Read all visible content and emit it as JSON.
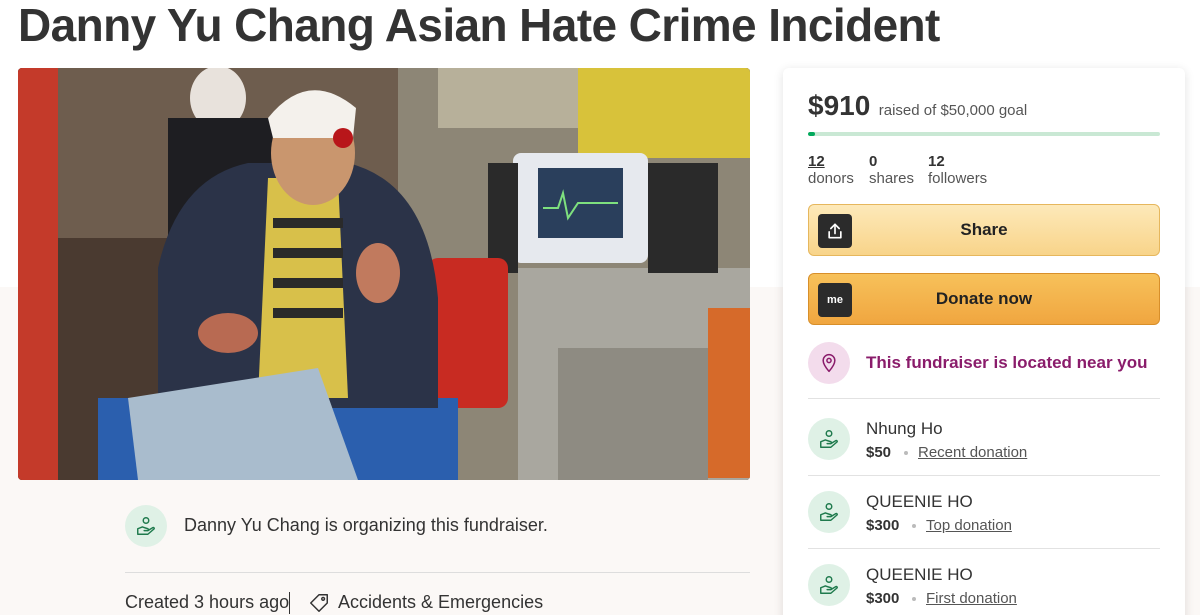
{
  "page": {
    "title": "Danny Yu Chang Asian Hate Crime Incident"
  },
  "organizer": {
    "text": "Danny Yu Chang is organizing this fundraiser.",
    "created": "Created 3 hours ago",
    "category": "Accidents & Emergencies"
  },
  "campaign": {
    "raised": "$910",
    "goal_text": "raised of $50,000 goal",
    "progress_fraction": 0.018,
    "stats": {
      "donors_count": "12",
      "donors_label": "donors",
      "shares_count": "0",
      "shares_label": "shares",
      "followers_count": "12",
      "followers_label": "followers"
    },
    "share_label": "Share",
    "donate_label": "Donate now",
    "donate_icon_text": "me",
    "location_text": "This fundraiser is located near you"
  },
  "donations": [
    {
      "name": "Nhung Ho",
      "amount": "$50",
      "type": "Recent donation"
    },
    {
      "name": "QUEENIE HO",
      "amount": "$300",
      "type": "Top donation"
    },
    {
      "name": "QUEENIE HO",
      "amount": "$300",
      "type": "First donation"
    }
  ],
  "icons": {
    "share": "share-upload-icon",
    "donate": "gofundme-icon",
    "location": "location-pin-icon",
    "donor": "hand-heart-icon",
    "category": "tag-icon"
  },
  "colors": {
    "accent_green": "#02a95c",
    "share_button": "#f8d48a",
    "donate_button": "#f0a640",
    "location_text": "#8a1c6b"
  }
}
